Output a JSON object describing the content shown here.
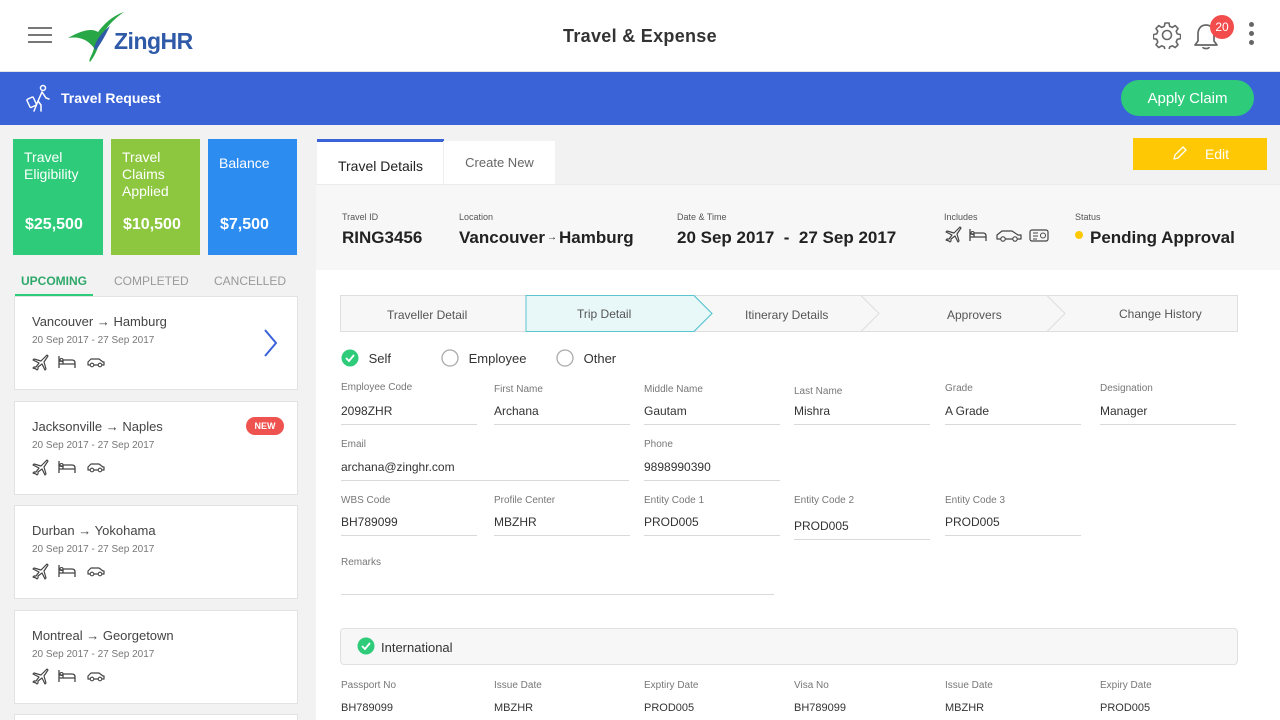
{
  "header": {
    "logo_text": "ZingHR",
    "title": "Travel & Expense",
    "notification_count": "20"
  },
  "subheader": {
    "label": "Travel Request",
    "apply_claim": "Apply Claim"
  },
  "cards": [
    {
      "title": "Travel Eligibility",
      "value": "$25,500",
      "color": "#2ecc7a"
    },
    {
      "title": "Travel Claims Applied",
      "value": "$10,500",
      "color": "#8dc63f"
    },
    {
      "title": "Balance",
      "value": "$7,500",
      "color": "#2d8cf0"
    }
  ],
  "trip_tabs": [
    "UPCOMING",
    "COMPLETED",
    "CANCELLED"
  ],
  "trips": [
    {
      "from": "Vancouver",
      "to": "Hamburg",
      "dates": "20 Sep 2017  -  27 Sep 2017",
      "new": ""
    },
    {
      "from": "Jacksonville",
      "to": "Naples",
      "dates": "20 Sep 2017  -  27 Sep 2017",
      "new": "NEW"
    },
    {
      "from": "Durban",
      "to": "Yokohama",
      "dates": "20 Sep 2017  -  27 Sep 2017",
      "new": ""
    },
    {
      "from": "Montreal",
      "to": "Georgetown",
      "dates": "20 Sep 2017  -  27 Sep 2017",
      "new": ""
    }
  ],
  "main_tabs": [
    "Travel Details",
    "Create New"
  ],
  "edit_label": "Edit",
  "summary": {
    "travel_id_label": "Travel ID",
    "travel_id": "RING3456",
    "location_label": "Location",
    "location_from": "Vancouver",
    "location_to": "Hamburg",
    "date_label": "Date & Time",
    "date_value": "20 Sep 2017  -  27 Sep 2017",
    "includes_label": "Includes",
    "status_label": "Status",
    "status_value": "Pending Approval",
    "status_color": "#ffc805"
  },
  "steps": [
    "Traveller Detail",
    "Trip Detail",
    "Itinerary Details",
    "Approvers",
    "Change History"
  ],
  "traveller_type": {
    "options": [
      "Self",
      "Employee",
      "Other"
    ],
    "selected": "Self"
  },
  "fields": {
    "employee_code": {
      "label": "Employee Code",
      "value": "2098ZHR"
    },
    "first_name": {
      "label": "First Name",
      "value": "Archana"
    },
    "middle_name": {
      "label": "Middle Name",
      "value": "Gautam"
    },
    "last_name": {
      "label": "Last Name",
      "value": "Mishra"
    },
    "grade": {
      "label": "Grade",
      "value": "A Grade"
    },
    "designation": {
      "label": "Designation",
      "value": "Manager"
    },
    "email": {
      "label": "Email",
      "value": "archana@zinghr.com"
    },
    "phone": {
      "label": "Phone",
      "value": "9898990390"
    },
    "wbs_code": {
      "label": "WBS Code",
      "value": "BH789099"
    },
    "profile_center": {
      "label": "Profile Center",
      "value": "MBZHR"
    },
    "entity_code_1": {
      "label": "Entity Code 1",
      "value": "PROD005"
    },
    "entity_code_2": {
      "label": "Entity Code 2",
      "value": "PROD005"
    },
    "entity_code_3": {
      "label": "Entity Code 3",
      "value": "PROD005"
    },
    "remarks": {
      "label": "Remarks",
      "value": ""
    }
  },
  "international": {
    "label": "International",
    "passport_no": {
      "label": "Passport No",
      "value": "BH789099"
    },
    "issue_date": {
      "label": "Issue Date",
      "value": "MBZHR"
    },
    "expiry_date": {
      "label": "Exptiry Date",
      "value": "PROD005"
    },
    "visa_no": {
      "label": "Visa No",
      "value": "BH789099"
    },
    "visa_issue_date": {
      "label": "Issue Date",
      "value": "MBZHR"
    },
    "visa_expiry_date": {
      "label": "Expiry Date",
      "value": "PROD005"
    }
  }
}
